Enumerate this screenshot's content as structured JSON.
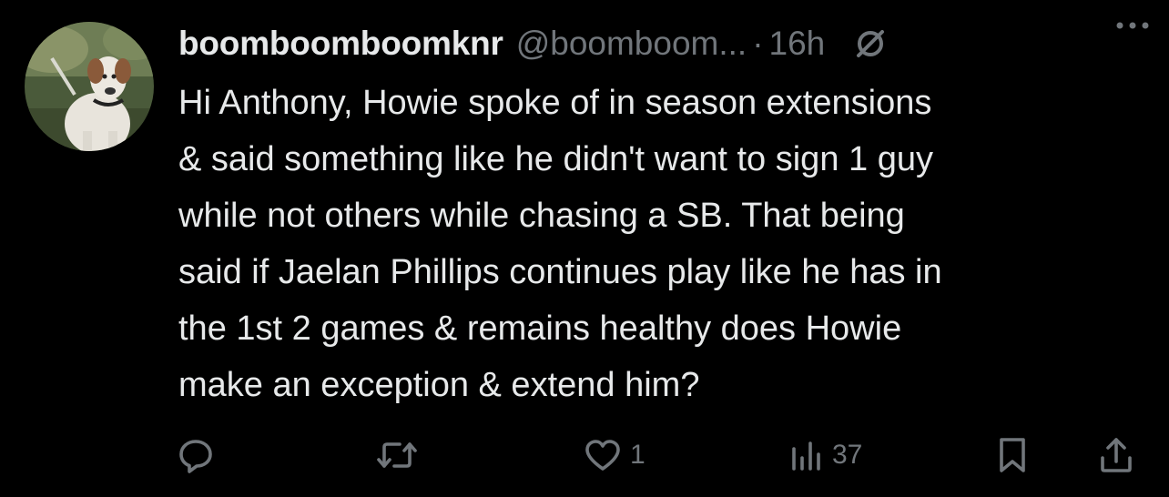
{
  "author": {
    "display_name": "boomboomboomknr",
    "handle": "@boomboom...",
    "separator": "·",
    "time": "16h"
  },
  "tweet": {
    "text": "Hi Anthony, Howie spoke of in season extensions\n& said something like he didn't want to sign 1 guy\nwhile not others while chasing a SB. That being\nsaid if Jaelan Phillips continues play like he has in\nthe 1st 2 games & remains healthy does Howie\nmake an exception & extend him?"
  },
  "actions": {
    "reply_count": "",
    "retweet_count": "",
    "like_count": "1",
    "views_count": "37"
  },
  "icons": {
    "grok": "grok-slash-circle-icon",
    "more": "more-horizontal-icon",
    "reply": "reply-bubble-icon",
    "retweet": "retweet-icon",
    "like": "heart-icon",
    "views": "analytics-bars-icon",
    "bookmark": "bookmark-icon",
    "share": "share-icon"
  },
  "colors": {
    "background": "#000000",
    "primary_text": "#e7e9ea",
    "secondary_text": "#71767b"
  }
}
